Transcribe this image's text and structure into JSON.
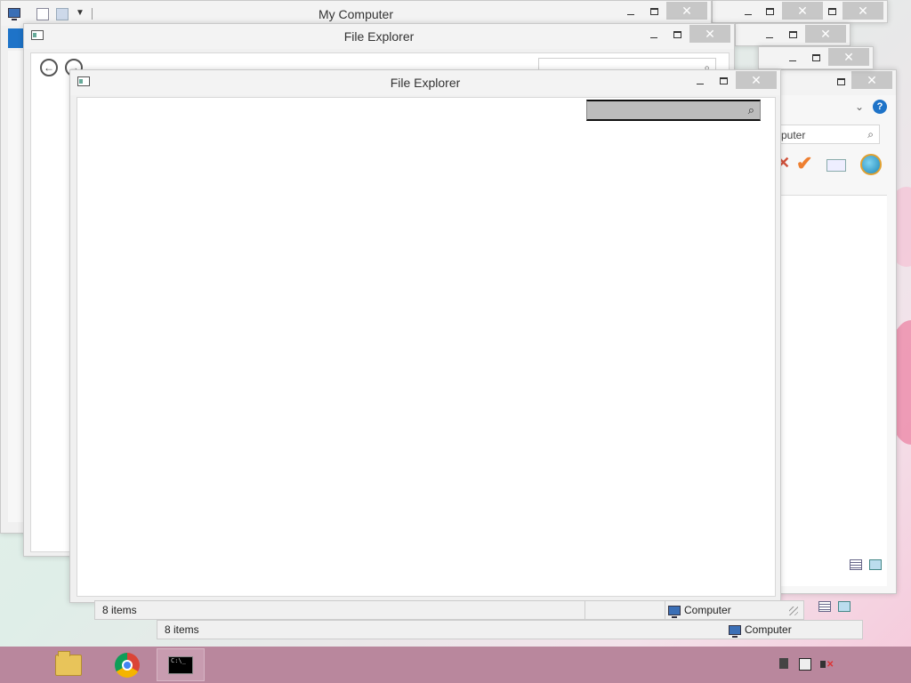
{
  "windows": {
    "my_computer": {
      "title": "My Computer"
    },
    "explorer_back": {
      "title": "File Explorer"
    },
    "explorer_front": {
      "title": "File Explorer",
      "search_placeholder": ""
    },
    "right_window": {
      "search_text": "puter"
    }
  },
  "status": {
    "front_items": "8 items",
    "front_location": "Computer",
    "back_items": "8 items",
    "back_location": "Computer"
  },
  "taskbar": {
    "apps": [
      {
        "name": "file-explorer",
        "icon": "folder-icon"
      },
      {
        "name": "chrome",
        "icon": "chrome-icon"
      },
      {
        "name": "command-prompt",
        "icon": "cmd-icon",
        "active": true,
        "glyph": "C:\\_"
      }
    ],
    "tray": [
      "action-center-icon",
      "network-icon",
      "volume-muted-icon"
    ]
  },
  "controls": {
    "close": "✕",
    "search_icon": "⌕",
    "back": "←",
    "forward": "→",
    "help": "?"
  },
  "colors": {
    "taskbar": "#b9879d",
    "close_button": "#c7c7c7",
    "accent_blue": "#1e73c8"
  }
}
